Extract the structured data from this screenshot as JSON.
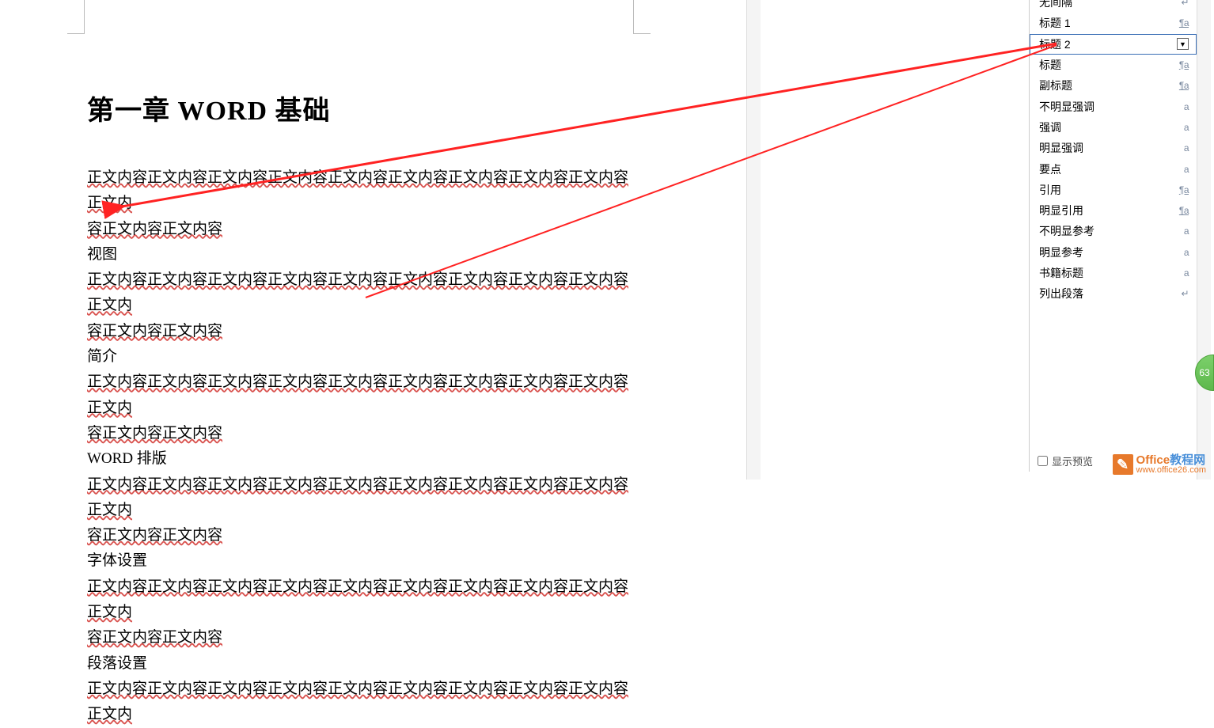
{
  "doc": {
    "heading": "第一章   WORD 基础",
    "body_repeat": "正文内容正文内容正文内容正文内容正文内容正文内容正文内容正文内容正文内容正文内",
    "body_tail": "容正文内容正文内容",
    "sub_headings": [
      "视图",
      "简介",
      "WORD 排版",
      "字体设置",
      "段落设置"
    ],
    "last_partial": "正文内容正文内容正文内容正文内容正文内容正文内容正文内容正文内容正文内容正文内"
  },
  "styles": [
    {
      "label": "无间隔",
      "marker": "↵",
      "type": "ret"
    },
    {
      "label": "标题 1",
      "marker": "¶a",
      "type": "para",
      "underline": true
    },
    {
      "label": "标题 2",
      "marker": "▾",
      "type": "sel",
      "selected": true
    },
    {
      "label": "标题",
      "marker": "¶a",
      "type": "para",
      "underline": true
    },
    {
      "label": "副标题",
      "marker": "¶a",
      "type": "para",
      "underline": true
    },
    {
      "label": "不明显强调",
      "marker": "a",
      "type": "char"
    },
    {
      "label": "强调",
      "marker": "a",
      "type": "char"
    },
    {
      "label": "明显强调",
      "marker": "a",
      "type": "char"
    },
    {
      "label": "要点",
      "marker": "a",
      "type": "char"
    },
    {
      "label": "引用",
      "marker": "¶a",
      "type": "para",
      "underline": true
    },
    {
      "label": "明显引用",
      "marker": "¶a",
      "type": "para",
      "underline": true
    },
    {
      "label": "不明显参考",
      "marker": "a",
      "type": "char"
    },
    {
      "label": "明显参考",
      "marker": "a",
      "type": "char"
    },
    {
      "label": "书籍标题",
      "marker": "a",
      "type": "char"
    },
    {
      "label": "列出段落",
      "marker": "↵",
      "type": "ret"
    }
  ],
  "pane_footer": "显示预览",
  "badge": "63",
  "watermark": {
    "brand_a": "Office",
    "brand_b": "教程网",
    "url": "www.office26.com"
  }
}
